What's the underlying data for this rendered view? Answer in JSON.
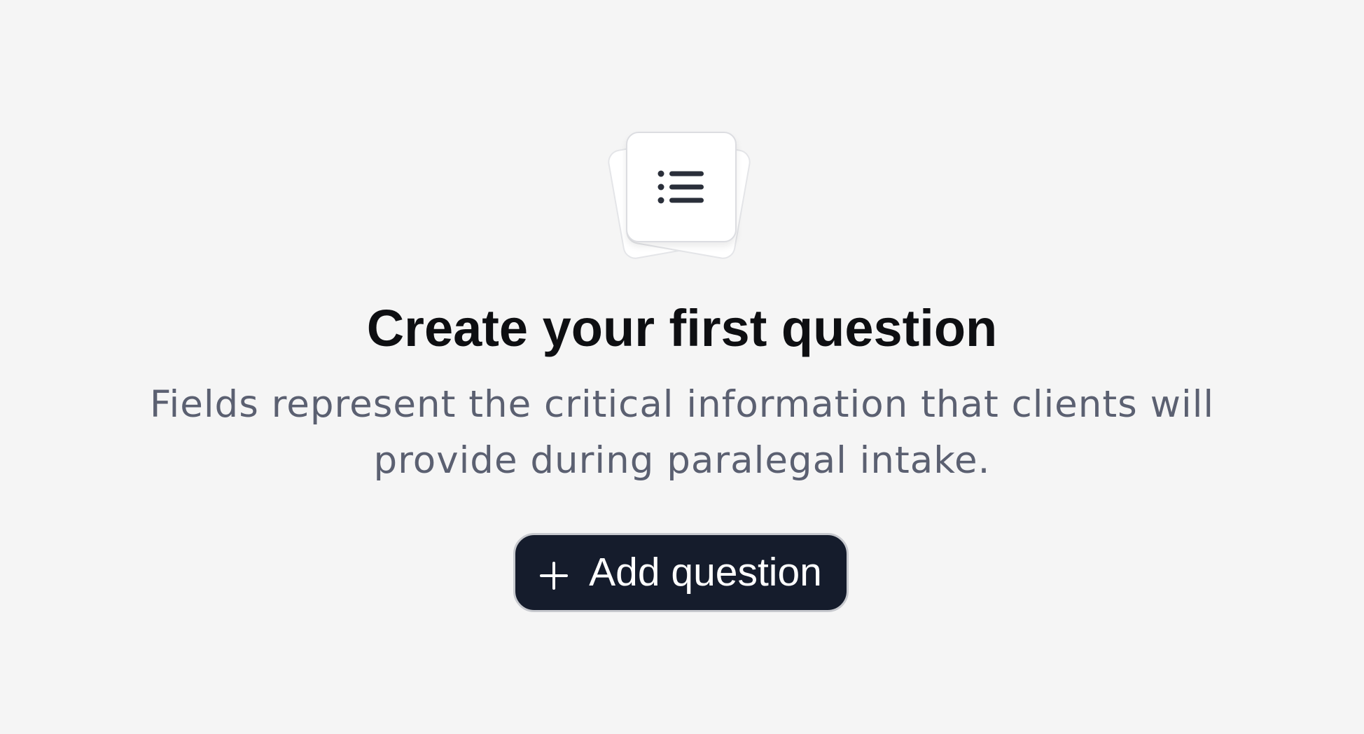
{
  "empty_state": {
    "icon": "list-icon",
    "title": "Create your first question",
    "description": "Fields represent the critical information that clients will provide during paralegal intake.",
    "add_button": {
      "icon": "plus-icon",
      "label": "Add question"
    }
  },
  "colors": {
    "background": "#f5f5f5",
    "title": "#0e0f12",
    "description": "#5b6071",
    "button_background": "#151c2c",
    "button_text": "#ffffff"
  }
}
